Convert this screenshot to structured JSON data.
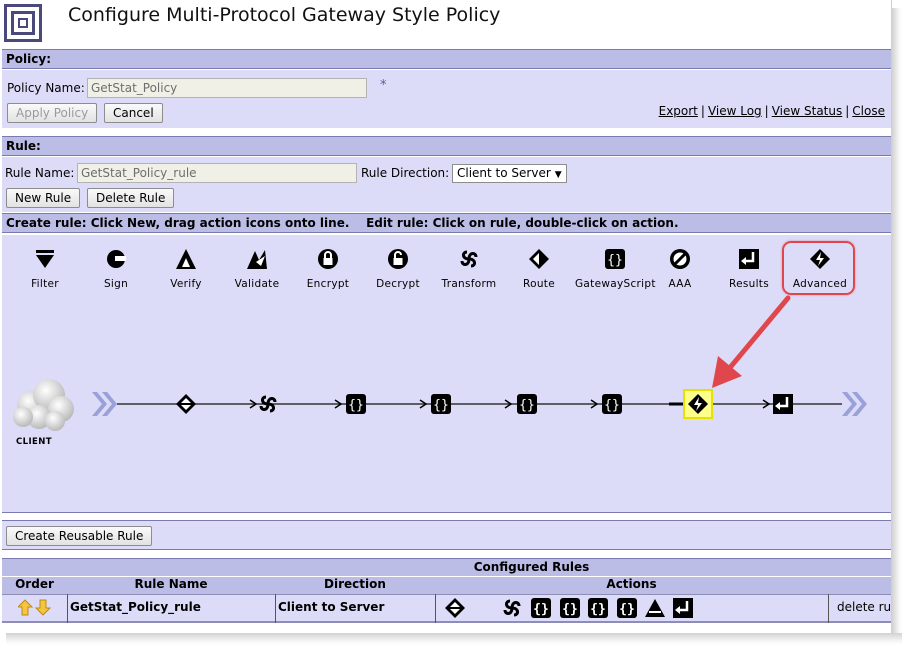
{
  "page": {
    "title": "Configure Multi-Protocol Gateway Style Policy"
  },
  "policy": {
    "section_label": "Policy:",
    "name_label": "Policy Name:",
    "name_value": "GetStat_Policy",
    "required_mark": "*",
    "apply_button": "Apply Policy",
    "cancel_button": "Cancel",
    "links": [
      "Export",
      "View Log",
      "View Status",
      "Close"
    ]
  },
  "rule": {
    "section_label": "Rule:",
    "name_label": "Rule Name:",
    "name_value": "GetStat_Policy_rule",
    "direction_label": "Rule Direction:",
    "direction_value": "Client to Server",
    "new_button": "New Rule",
    "delete_button": "Delete Rule",
    "instructions": "Create rule: Click New, drag action icons onto line.    Edit rule: Click on rule, double-click on action."
  },
  "palette": [
    {
      "label": "Filter",
      "icon": "filter-icon"
    },
    {
      "label": "Sign",
      "icon": "sign-icon"
    },
    {
      "label": "Verify",
      "icon": "verify-icon"
    },
    {
      "label": "Validate",
      "icon": "validate-icon"
    },
    {
      "label": "Encrypt",
      "icon": "encrypt-icon"
    },
    {
      "label": "Decrypt",
      "icon": "decrypt-icon"
    },
    {
      "label": "Transform",
      "icon": "transform-icon"
    },
    {
      "label": "Route",
      "icon": "route-icon"
    },
    {
      "label": "GatewayScript",
      "icon": "gatewayscript-icon"
    },
    {
      "label": "AAA",
      "icon": "aaa-icon"
    },
    {
      "label": "Results",
      "icon": "results-icon"
    },
    {
      "label": "Advanced",
      "icon": "advanced-icon"
    }
  ],
  "canvas": {
    "client_label": "CLIENT",
    "actions": [
      "route-icon",
      "transform-icon",
      "gatewayscript-icon",
      "gatewayscript-icon",
      "gatewayscript-icon",
      "gatewayscript-icon",
      "advanced-icon",
      "results-icon"
    ],
    "selected_action": "advanced-icon"
  },
  "reusable": {
    "button": "Create Reusable Rule"
  },
  "configured_rules": {
    "title": "Configured Rules",
    "headers": [
      "Order",
      "Rule Name",
      "Direction",
      "Actions"
    ],
    "rows": [
      {
        "rule_name": "GetStat_Policy_rule",
        "direction": "Client to Server",
        "actions": [
          "route-icon",
          "transform-icon",
          "gatewayscript-icon",
          "gatewayscript-icon",
          "gatewayscript-icon",
          "gatewayscript-icon",
          "aaa-warning-icon",
          "results-icon"
        ],
        "delete_link": "delete ru"
      }
    ]
  },
  "colors": {
    "section_bar": "#bcbde6",
    "panel": "#dcdcf8",
    "callout": "#e0474c",
    "selection": "#ffff8c"
  }
}
